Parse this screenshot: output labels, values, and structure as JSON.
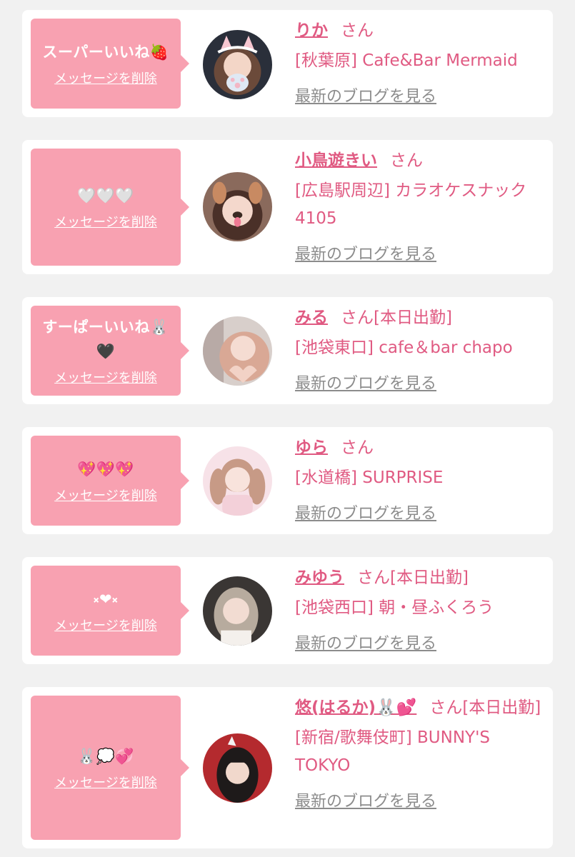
{
  "colors": {
    "bubble": "#f8a1b1",
    "accent": "#e05a82",
    "link_gray": "#8c8c8c",
    "background": "#f1f1f1"
  },
  "delete_label": "メッセージを削除",
  "blog_label": "最新のブログを見る",
  "cards": [
    {
      "message": "スーパーいいね🍓",
      "name": "りか",
      "suffix": "さん",
      "shop": "[秋葉原] Cafe&Bar Mermaid",
      "avatar_icon": "girl-avatar-cat-ears"
    },
    {
      "message": "🤍🤍🤍",
      "name": "小鳥遊きい",
      "suffix": "さん",
      "shop": "[広島駅周辺] カラオケスナック 4105",
      "avatar_icon": "girl-avatar-dog-filter"
    },
    {
      "message": "すーぱーいいね🐰🖤",
      "name": "みる",
      "suffix": "さん[本日出勤]",
      "shop": "[池袋東口] cafe＆bar chapo",
      "avatar_icon": "girl-avatar-heart-hands"
    },
    {
      "message": "💖💖💖",
      "name": "ゆら",
      "suffix": "さん",
      "shop": "[水道橋] SURPRISE",
      "avatar_icon": "girl-avatar-twintails"
    },
    {
      "message": "༝❤︎༝",
      "name": "みゆう",
      "suffix": "さん[本日出勤]",
      "shop": "[池袋西口] 朝・昼ふくろう",
      "avatar_icon": "girl-avatar-ash-hair"
    },
    {
      "message": "🐰💭💞",
      "name": "悠(はるか)🐰💕",
      "suffix": "さん[本日出勤]",
      "shop": "[新宿/歌舞伎町] BUNNY'S TOKYO",
      "avatar_icon": "girl-avatar-red-bg"
    }
  ]
}
